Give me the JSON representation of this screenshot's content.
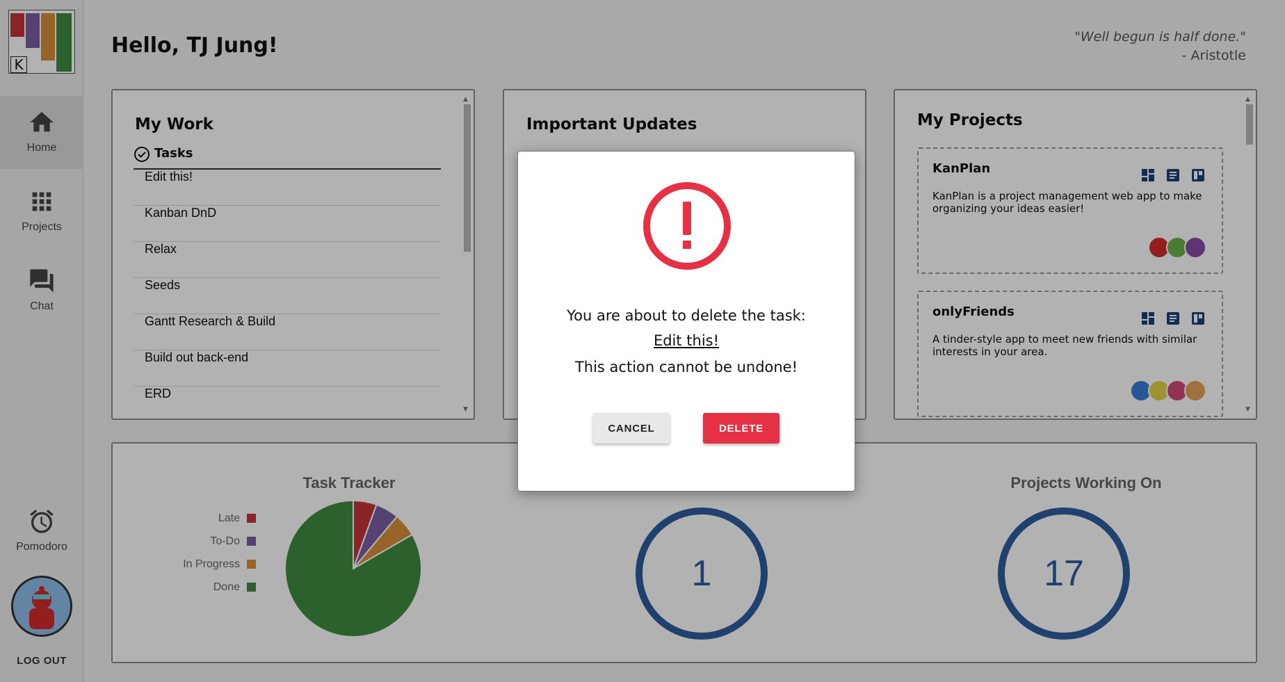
{
  "sidebar": {
    "logo_letter": "K",
    "nav": [
      {
        "label": "Home",
        "icon": "home-icon",
        "active": true
      },
      {
        "label": "Projects",
        "icon": "grid-icon"
      },
      {
        "label": "Chat",
        "icon": "chat-icon"
      }
    ],
    "pomodoro": {
      "label": "Pomodoro",
      "icon": "alarm-clock-icon"
    },
    "logout": "LOG OUT"
  },
  "header": {
    "greeting": "Hello, TJ Jung!",
    "quote": "\"Well begun is half done.\"",
    "quote_author": "- Aristotle"
  },
  "my_work": {
    "title": "My Work",
    "tab": "Tasks",
    "tasks": [
      "Edit this!",
      "Kanban DnD",
      "Relax",
      "Seeds",
      "Gantt Research & Build",
      "Build out back-end",
      "ERD"
    ]
  },
  "updates": {
    "title": "Important Updates"
  },
  "my_projects": {
    "title": "My Projects",
    "projects": [
      {
        "name": "KanPlan",
        "description": "KanPlan is a project management web app to make organizing your ideas easier!",
        "members": 3
      },
      {
        "name": "onlyFriends",
        "description": "A tinder-style app to meet new friends with similar interests in your area.",
        "members": 4
      }
    ]
  },
  "stats": {
    "task_tracker_title": "Task Tracker",
    "projects_title": "Projects Working On",
    "middle_value": "1",
    "projects_value": "17"
  },
  "chart_data": {
    "type": "pie",
    "title": "Task Tracker",
    "legend_position": "left",
    "categories": [
      "Late",
      "To-Do",
      "In Progress",
      "Done"
    ],
    "values": [
      1,
      1,
      1,
      15
    ],
    "colors": [
      "#c4343c",
      "#7a5fa5",
      "#d98e3a",
      "#3f8a3f"
    ]
  },
  "modal": {
    "line1": "You are about to delete the task:",
    "task_name": "Edit this!",
    "warning": "This action cannot be undone!",
    "cancel_label": "CANCEL",
    "delete_label": "DELETE",
    "accent": "#e63144"
  }
}
